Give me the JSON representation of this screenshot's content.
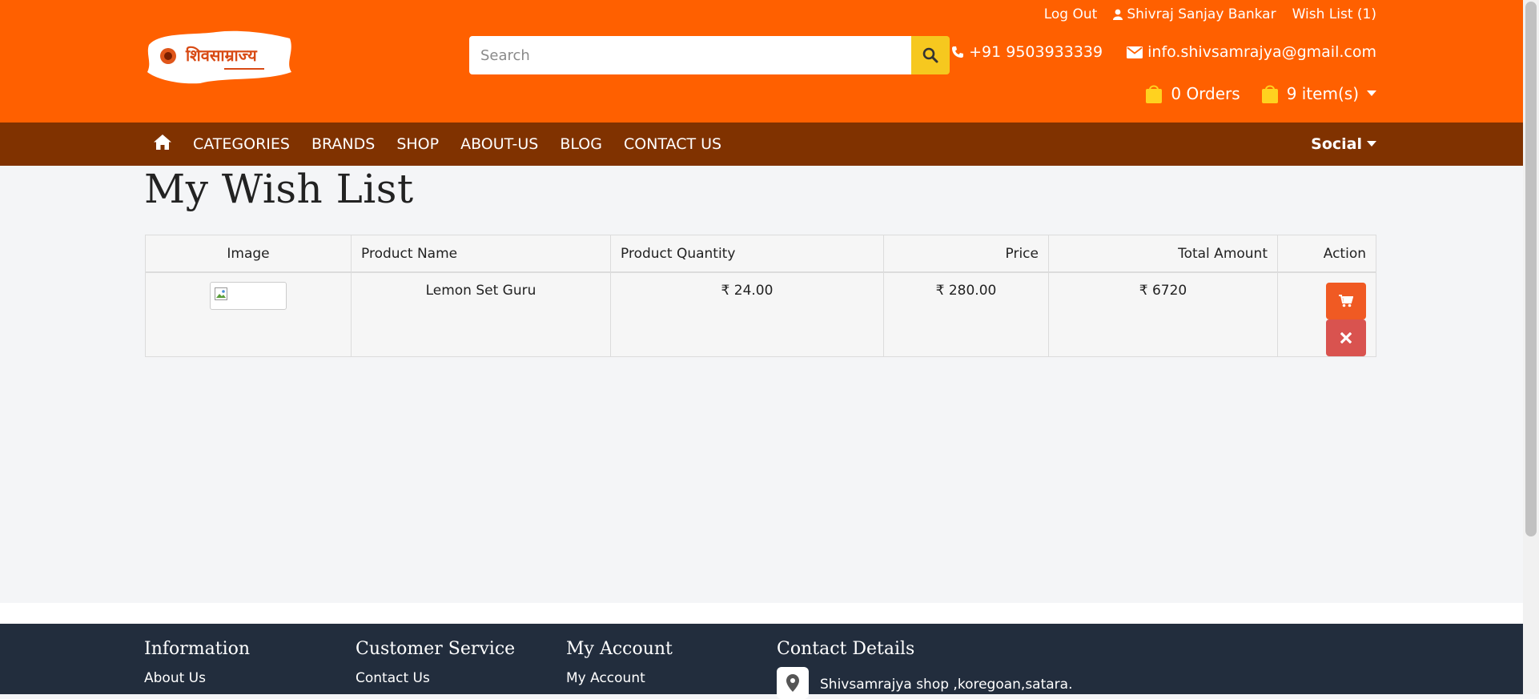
{
  "header": {
    "logo_text": "शिवसाम्राज्य",
    "search": {
      "placeholder": "Search",
      "value": ""
    },
    "top_links": {
      "logout": "Log Out",
      "user_name": "Shivraj Sanjay Bankar",
      "wishlist": "Wish List (1)"
    },
    "contact": {
      "phone": "+91 9503933339",
      "email": "info.shivsamrajya@gmail.com"
    },
    "orders": "0 Orders",
    "cart": "9 item(s)",
    "colors": {
      "topbar": "#ff6000",
      "navbar": "#803200",
      "search_button": "#f6c81f",
      "bag_icon": "#ffd21f"
    }
  },
  "nav": {
    "items": [
      "CATEGORIES",
      "BRANDS",
      "SHOP",
      "ABOUT-US",
      "BLOG",
      "CONTACT US"
    ],
    "social": "Social"
  },
  "main": {
    "title": "My Wish List",
    "table": {
      "columns": [
        "Image",
        "Product Name",
        "Product Quantity",
        "Price",
        "Total Amount",
        "Action"
      ],
      "rows": [
        {
          "name": "Lemon Set Guru",
          "quantity": "₹ 24.00",
          "price": "₹ 280.00",
          "total": "₹ 6720"
        }
      ]
    }
  },
  "footer": {
    "columns": [
      {
        "heading": "Information",
        "link": "About Us"
      },
      {
        "heading": "Customer Service",
        "link": "Contact Us"
      },
      {
        "heading": "My Account",
        "link": "My Account"
      },
      {
        "heading": "Contact Details",
        "link": "Shivsamrajya shop ,koregoan,satara."
      }
    ]
  }
}
